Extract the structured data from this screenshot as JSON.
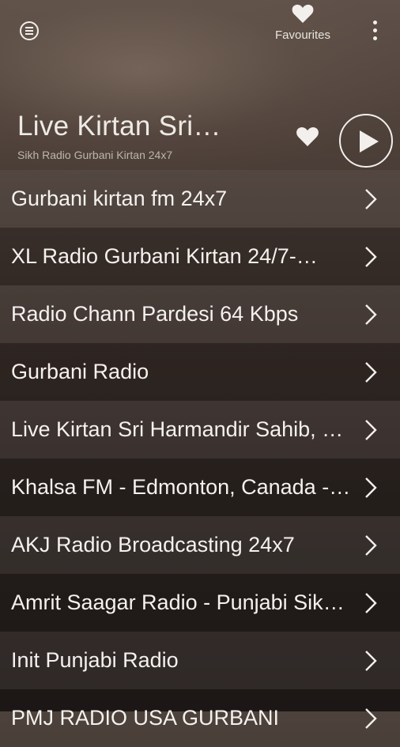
{
  "topbar": {
    "favourites_label": "Favourites"
  },
  "header": {
    "title": "Live Kirtan Sri…",
    "subtitle": "Sikh Radio Gurbani Kirtan 24x7"
  },
  "stations": [
    {
      "label": "Gurbani kirtan fm 24x7"
    },
    {
      "label": "XL Radio Gurbani Kirtan 24/7-…"
    },
    {
      "label": "Radio Chann Pardesi 64 Kbps"
    },
    {
      "label": "Gurbani Radio"
    },
    {
      "label": "Live Kirtan Sri Harmandir Sahib, …"
    },
    {
      "label": "Khalsa FM - Edmonton, Canada -…"
    },
    {
      "label": "AKJ Radio Broadcasting 24x7"
    },
    {
      "label": "Amrit Saagar Radio - Punjabi Sikh…"
    },
    {
      "label": "Init Punjabi Radio"
    },
    {
      "label": "PMJ RADIO USA GURBANI"
    }
  ],
  "colors": {
    "text": "#f4f1ee",
    "icon": "#f2efec"
  }
}
